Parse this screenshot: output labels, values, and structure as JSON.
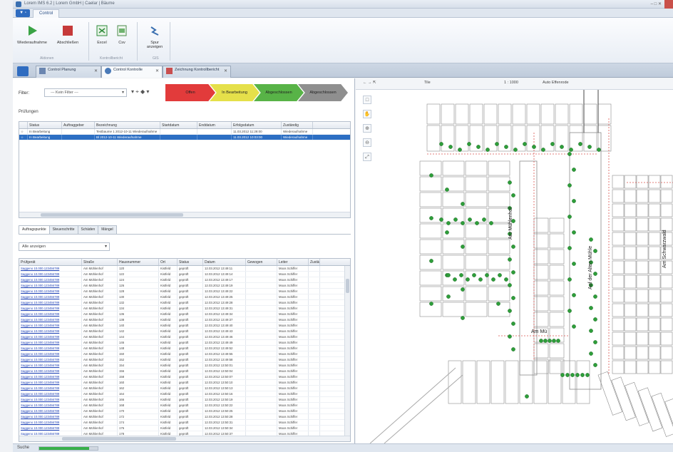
{
  "window": {
    "title": "Lorem IMS 6.2 | Lorem GmbH | Caelar | Bäume",
    "controls": "– □ ✕"
  },
  "ribbon": {
    "file_tab": "▼ ▫",
    "tab_label": "Control",
    "buttons": [
      {
        "label": "Wiederaufnahme",
        "icon": "play-icon"
      },
      {
        "label": "Abschließen",
        "icon": "stop-icon"
      },
      {
        "label": "Excel",
        "icon": "excel-icon"
      },
      {
        "label": "Csv",
        "icon": "csv-icon"
      },
      {
        "label": "Spur anzeigen",
        "icon": "track-icon"
      }
    ],
    "groups": [
      "Aktionen",
      "Kontrollbericht",
      "GIS"
    ]
  },
  "doc_tabs": [
    {
      "label": "Control Planung"
    },
    {
      "label": "Control Kontrolle"
    },
    {
      "label": "Zeichnung Kontrollbericht"
    }
  ],
  "filter": {
    "label": "Filter:",
    "value": "--- Kein Filter ---",
    "icons": "▾ ⌖ ◆ ▾"
  },
  "status_flow": [
    {
      "label": "Offen",
      "color": "#e23b3b"
    },
    {
      "label": "In Bearbeitung",
      "color": "#e5e04a"
    },
    {
      "label": "Abgeschlossen",
      "color": "#58b347"
    },
    {
      "label": "Abgeschlossen",
      "color": "#8f8f8f"
    }
  ],
  "pruefungen": {
    "label": "Prüfungen",
    "columns": [
      "",
      "Status",
      "Auftraggeber",
      "Bezeichnung",
      "Startdatum",
      "Enddatum",
      "Erfolgsdatum",
      "Zuständig"
    ],
    "rows": [
      [
        "☆",
        "In Bearbeitung",
        "",
        "Testbaume 1 2012-10-11 Wiederaufnahme",
        "",
        "",
        "11.03.2012 11:28:00",
        "Wiederaufnahme"
      ],
      [
        "☆",
        "In Bearbeitung",
        "",
        "Bl 2012-10-11 Wiederaufnahme",
        "",
        "",
        "11.03.2012 10:03:00",
        "Wiederaufnahme"
      ]
    ]
  },
  "subtabs": [
    "Auftragspunkte",
    "Steuerschritte",
    "Schäden",
    "Mängel"
  ],
  "show_select": "Alle anzeigen",
  "detail_grid": {
    "columns": [
      "Prüfgerät",
      "Straße",
      "Hausnummer",
      "Ort",
      "Status",
      "Datum",
      "Gewogen",
      "Leiter",
      "Zustän"
    ],
    "rows": [
      [
        "Saggeno 10.000.123456789",
        "Am Mühlenhof",
        "120",
        "Kistfeld",
        "geprüft",
        "12.03.2012 13:49:11",
        "",
        "Moos Schiffer",
        ""
      ],
      [
        "Saggeno 10.000.123456789",
        "Am Mühlenhof",
        "122",
        "Kistfeld",
        "geprüft",
        "12.03.2012 13:49:14",
        "",
        "Moos Schiffer",
        ""
      ],
      [
        "Saggeno 10.000.123456789",
        "Am Mühlenhof",
        "124",
        "Kistfeld",
        "geprüft",
        "12.03.2012 13:49:17",
        "",
        "Moos Schiffer",
        ""
      ],
      [
        "Saggeno 10.000.123456789",
        "Am Mühlenhof",
        "126",
        "Kistfeld",
        "geprüft",
        "12.03.2012 13:49:19",
        "",
        "Moos Schiffer",
        ""
      ],
      [
        "Saggeno 10.000.123456789",
        "Am Mühlenhof",
        "128",
        "Kistfeld",
        "geprüft",
        "12.03.2012 13:49:22",
        "",
        "Moos Schiffer",
        ""
      ],
      [
        "Saggeno 10.000.123456789",
        "Am Mühlenhof",
        "130",
        "Kistfeld",
        "geprüft",
        "12.03.2012 13:49:25",
        "",
        "Moos Schiffer",
        ""
      ],
      [
        "Saggeno 10.000.123456789",
        "Am Mühlenhof",
        "132",
        "Kistfeld",
        "geprüft",
        "12.03.2012 13:49:28",
        "",
        "Moos Schiffer",
        ""
      ],
      [
        "Saggeno 10.000.123456789",
        "Am Mühlenhof",
        "134",
        "Kistfeld",
        "geprüft",
        "12.03.2012 13:49:31",
        "",
        "Moos Schiffer",
        ""
      ],
      [
        "Saggeno 10.000.123456789",
        "Am Mühlenhof",
        "136",
        "Kistfeld",
        "geprüft",
        "12.03.2012 13:49:34",
        "",
        "Moos Schiffer",
        ""
      ],
      [
        "Saggeno 10.000.123456789",
        "Am Mühlenhof",
        "138",
        "Kistfeld",
        "geprüft",
        "12.03.2012 13:49:37",
        "",
        "Moos Schiffer",
        ""
      ],
      [
        "Saggeno 10.000.123456789",
        "Am Mühlenhof",
        "140",
        "Kistfeld",
        "geprüft",
        "12.03.2012 13:49:40",
        "",
        "Moos Schiffer",
        ""
      ],
      [
        "Saggeno 10.000.123456789",
        "Am Mühlenhof",
        "142",
        "Kistfeld",
        "geprüft",
        "12.03.2012 13:49:43",
        "",
        "Moos Schiffer",
        ""
      ],
      [
        "Saggeno 10.000.123456789",
        "Am Mühlenhof",
        "144",
        "Kistfeld",
        "geprüft",
        "12.03.2012 13:49:46",
        "",
        "Moos Schiffer",
        ""
      ],
      [
        "Saggeno 10.000.123456789",
        "Am Mühlenhof",
        "146",
        "Kistfeld",
        "geprüft",
        "12.03.2012 13:49:49",
        "",
        "Moos Schiffer",
        ""
      ],
      [
        "Saggeno 10.000.123456789",
        "Am Mühlenhof",
        "148",
        "Kistfeld",
        "geprüft",
        "12.03.2012 13:49:52",
        "",
        "Moos Schiffer",
        ""
      ],
      [
        "Saggeno 10.000.123456789",
        "Am Mühlenhof",
        "150",
        "Kistfeld",
        "geprüft",
        "12.03.2012 13:49:55",
        "",
        "Moos Schiffer",
        ""
      ],
      [
        "Saggeno 10.000.123456789",
        "Am Mühlenhof",
        "152",
        "Kistfeld",
        "geprüft",
        "12.03.2012 13:49:58",
        "",
        "Moos Schiffer",
        ""
      ],
      [
        "Saggeno 10.000.123456789",
        "Am Mühlenhof",
        "154",
        "Kistfeld",
        "geprüft",
        "12.03.2012 13:50:01",
        "",
        "Moos Schiffer",
        ""
      ],
      [
        "Saggeno 10.000.123456789",
        "Am Mühlenhof",
        "156",
        "Kistfeld",
        "geprüft",
        "12.03.2012 13:50:04",
        "",
        "Moos Schiffer",
        ""
      ],
      [
        "Saggeno 10.000.123456789",
        "Am Mühlenhof",
        "158",
        "Kistfeld",
        "geprüft",
        "12.03.2012 13:50:07",
        "",
        "Moos Schiffer",
        ""
      ],
      [
        "Saggeno 10.000.123456789",
        "Am Mühlenhof",
        "160",
        "Kistfeld",
        "geprüft",
        "12.03.2012 13:50:10",
        "",
        "Moos Schiffer",
        ""
      ],
      [
        "Saggeno 10.000.123456789",
        "Am Mühlenhof",
        "162",
        "Kistfeld",
        "geprüft",
        "12.03.2012 13:50:13",
        "",
        "Moos Schiffer",
        ""
      ],
      [
        "Saggeno 10.000.123456789",
        "Am Mühlenhof",
        "164",
        "Kistfeld",
        "geprüft",
        "12.03.2012 13:50:16",
        "",
        "Moos Schiffer",
        ""
      ],
      [
        "Saggeno 10.000.123456789",
        "Am Mühlenhof",
        "166",
        "Kistfeld",
        "geprüft",
        "12.03.2012 13:50:19",
        "",
        "Moos Schiffer",
        ""
      ],
      [
        "Saggeno 10.000.123456789",
        "Am Mühlenhof",
        "168",
        "Kistfeld",
        "geprüft",
        "12.03.2012 13:50:22",
        "",
        "Moos Schiffer",
        ""
      ],
      [
        "Saggeno 10.000.123456789",
        "Am Mühlenhof",
        "170",
        "Kistfeld",
        "geprüft",
        "12.03.2012 13:50:25",
        "",
        "Moos Schiffer",
        ""
      ],
      [
        "Saggeno 10.000.123456789",
        "Am Mühlenhof",
        "172",
        "Kistfeld",
        "geprüft",
        "12.03.2012 13:50:28",
        "",
        "Moos Schiffer",
        ""
      ],
      [
        "Saggeno 10.000.123456789",
        "Am Mühlenhof",
        "174",
        "Kistfeld",
        "geprüft",
        "12.03.2012 13:50:31",
        "",
        "Moos Schiffer",
        ""
      ],
      [
        "Saggeno 10.000.123456789",
        "Am Mühlenhof",
        "176",
        "Kistfeld",
        "geprüft",
        "12.03.2012 13:50:34",
        "",
        "Moos Schiffer",
        ""
      ],
      [
        "Saggeno 10.000.123456789",
        "Am Mühlenhof",
        "178",
        "Kistfeld",
        "geprüft",
        "12.03.2012 13:50:37",
        "",
        "Moos Schiffer",
        ""
      ]
    ]
  },
  "map": {
    "toolbar": {
      "scale": "1 : 1000",
      "layer": "Auto Effenrode",
      "pan_buttons": "← → ⇱",
      "zoom": "Tile"
    },
    "tools": [
      "□",
      "✋",
      "⊕",
      "⊖",
      "⤢"
    ],
    "streets": [
      "Am Mühlenhof",
      "Auf der Alten Mühle",
      "Am Schwarzwald",
      "Am Mü"
    ]
  },
  "status": {
    "label": "Suche",
    "progress": 0.85
  },
  "colors": {
    "accent": "#2c6ec3",
    "tree": "#2e9e3a",
    "parcel_red": "#d9534f"
  }
}
